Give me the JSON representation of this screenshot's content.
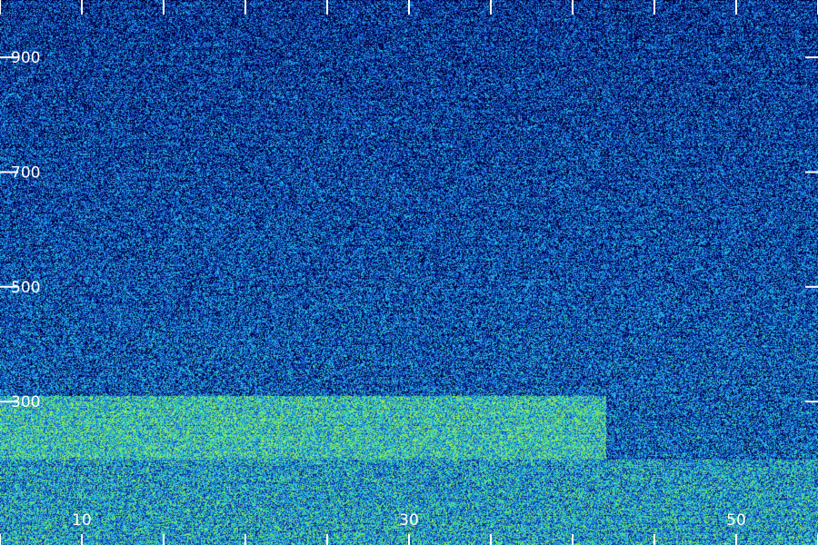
{
  "chart_data": {
    "type": "heatmap",
    "title": "",
    "xlabel": "",
    "ylabel": "",
    "xlim": [
      5,
      55
    ],
    "ylim": [
      50,
      1000
    ],
    "x_tick_labels": [
      "10",
      "30",
      "50"
    ],
    "x_tick_values": [
      10,
      30,
      50
    ],
    "x_minor_tick_values": [
      5,
      15,
      20,
      25,
      35,
      40,
      45,
      55
    ],
    "y_tick_labels": [
      "300",
      "500",
      "700",
      "900"
    ],
    "y_tick_values": [
      300,
      500,
      700,
      900
    ],
    "colormap": [
      "#000033",
      "#0a1a8c",
      "#1450c8",
      "#1e8ce6",
      "#28c8dc",
      "#50e678",
      "#a0f050"
    ],
    "description_bands": [
      {
        "y_range": [
          200,
          310
        ],
        "x_range": [
          5,
          42
        ],
        "intensity": "high"
      },
      {
        "y_range": [
          50,
          200
        ],
        "x_range": [
          5,
          55
        ],
        "intensity": "medium"
      },
      {
        "y_range": [
          310,
          1000
        ],
        "x_range": [
          5,
          55
        ],
        "intensity": "low"
      }
    ]
  },
  "colors": {
    "background": "#000033",
    "tick_color": "#ffffff",
    "label_color": "#ffffff"
  }
}
